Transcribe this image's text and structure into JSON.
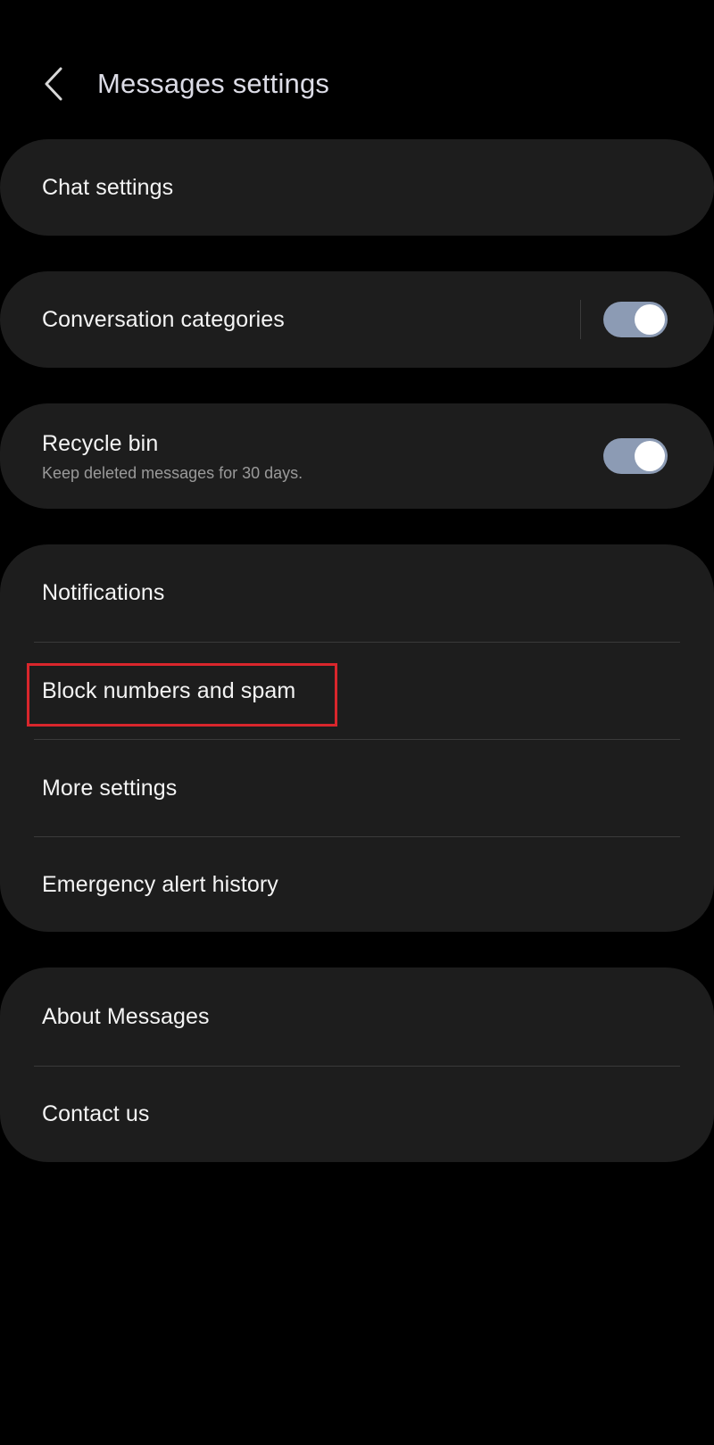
{
  "header": {
    "back_icon": "chevron-left-icon",
    "title": "Messages settings"
  },
  "chat_settings": {
    "label": "Chat settings"
  },
  "conversation_categories": {
    "label": "Conversation categories",
    "toggle_on": true
  },
  "recycle_bin": {
    "label": "Recycle bin",
    "sublabel": "Keep deleted messages for 30 days.",
    "toggle_on": true
  },
  "group_main": {
    "items": [
      {
        "label": "Notifications"
      },
      {
        "label": "Block numbers and spam",
        "highlighted": true
      },
      {
        "label": "More settings"
      },
      {
        "label": "Emergency alert history"
      }
    ]
  },
  "group_about": {
    "items": [
      {
        "label": "About Messages"
      },
      {
        "label": "Contact us"
      }
    ]
  },
  "colors": {
    "background": "#000000",
    "card": "#1d1d1d",
    "toggle_track_on": "#8c9bb4",
    "toggle_knob": "#ffffff",
    "highlight": "#d9262c"
  }
}
